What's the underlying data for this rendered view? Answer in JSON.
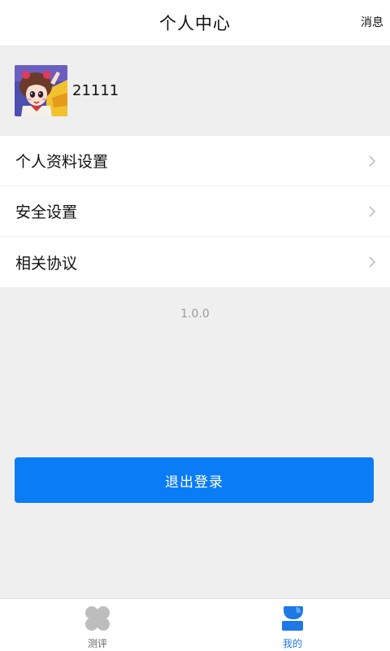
{
  "header": {
    "title": "个人中心",
    "message_label": "消息"
  },
  "profile": {
    "username": "21111",
    "avatar_icon": "avatar-cartoon-girl"
  },
  "menu": {
    "items": [
      {
        "label": "个人资料设置",
        "icon": "chevron-right-icon"
      },
      {
        "label": "安全设置",
        "icon": "chevron-right-icon"
      },
      {
        "label": "相关协议",
        "icon": "chevron-right-icon"
      }
    ]
  },
  "version": "1.0.0",
  "logout": {
    "label": "退出登录"
  },
  "tabbar": {
    "tabs": [
      {
        "label": "测评",
        "icon": "clover-icon",
        "active": false
      },
      {
        "label": "我的",
        "icon": "user-icon",
        "active": true
      }
    ]
  },
  "colors": {
    "primary": "#0a7cf5",
    "background": "#efefef",
    "active_tab": "#1e78e6",
    "inactive_icon": "#bdbdbd"
  }
}
